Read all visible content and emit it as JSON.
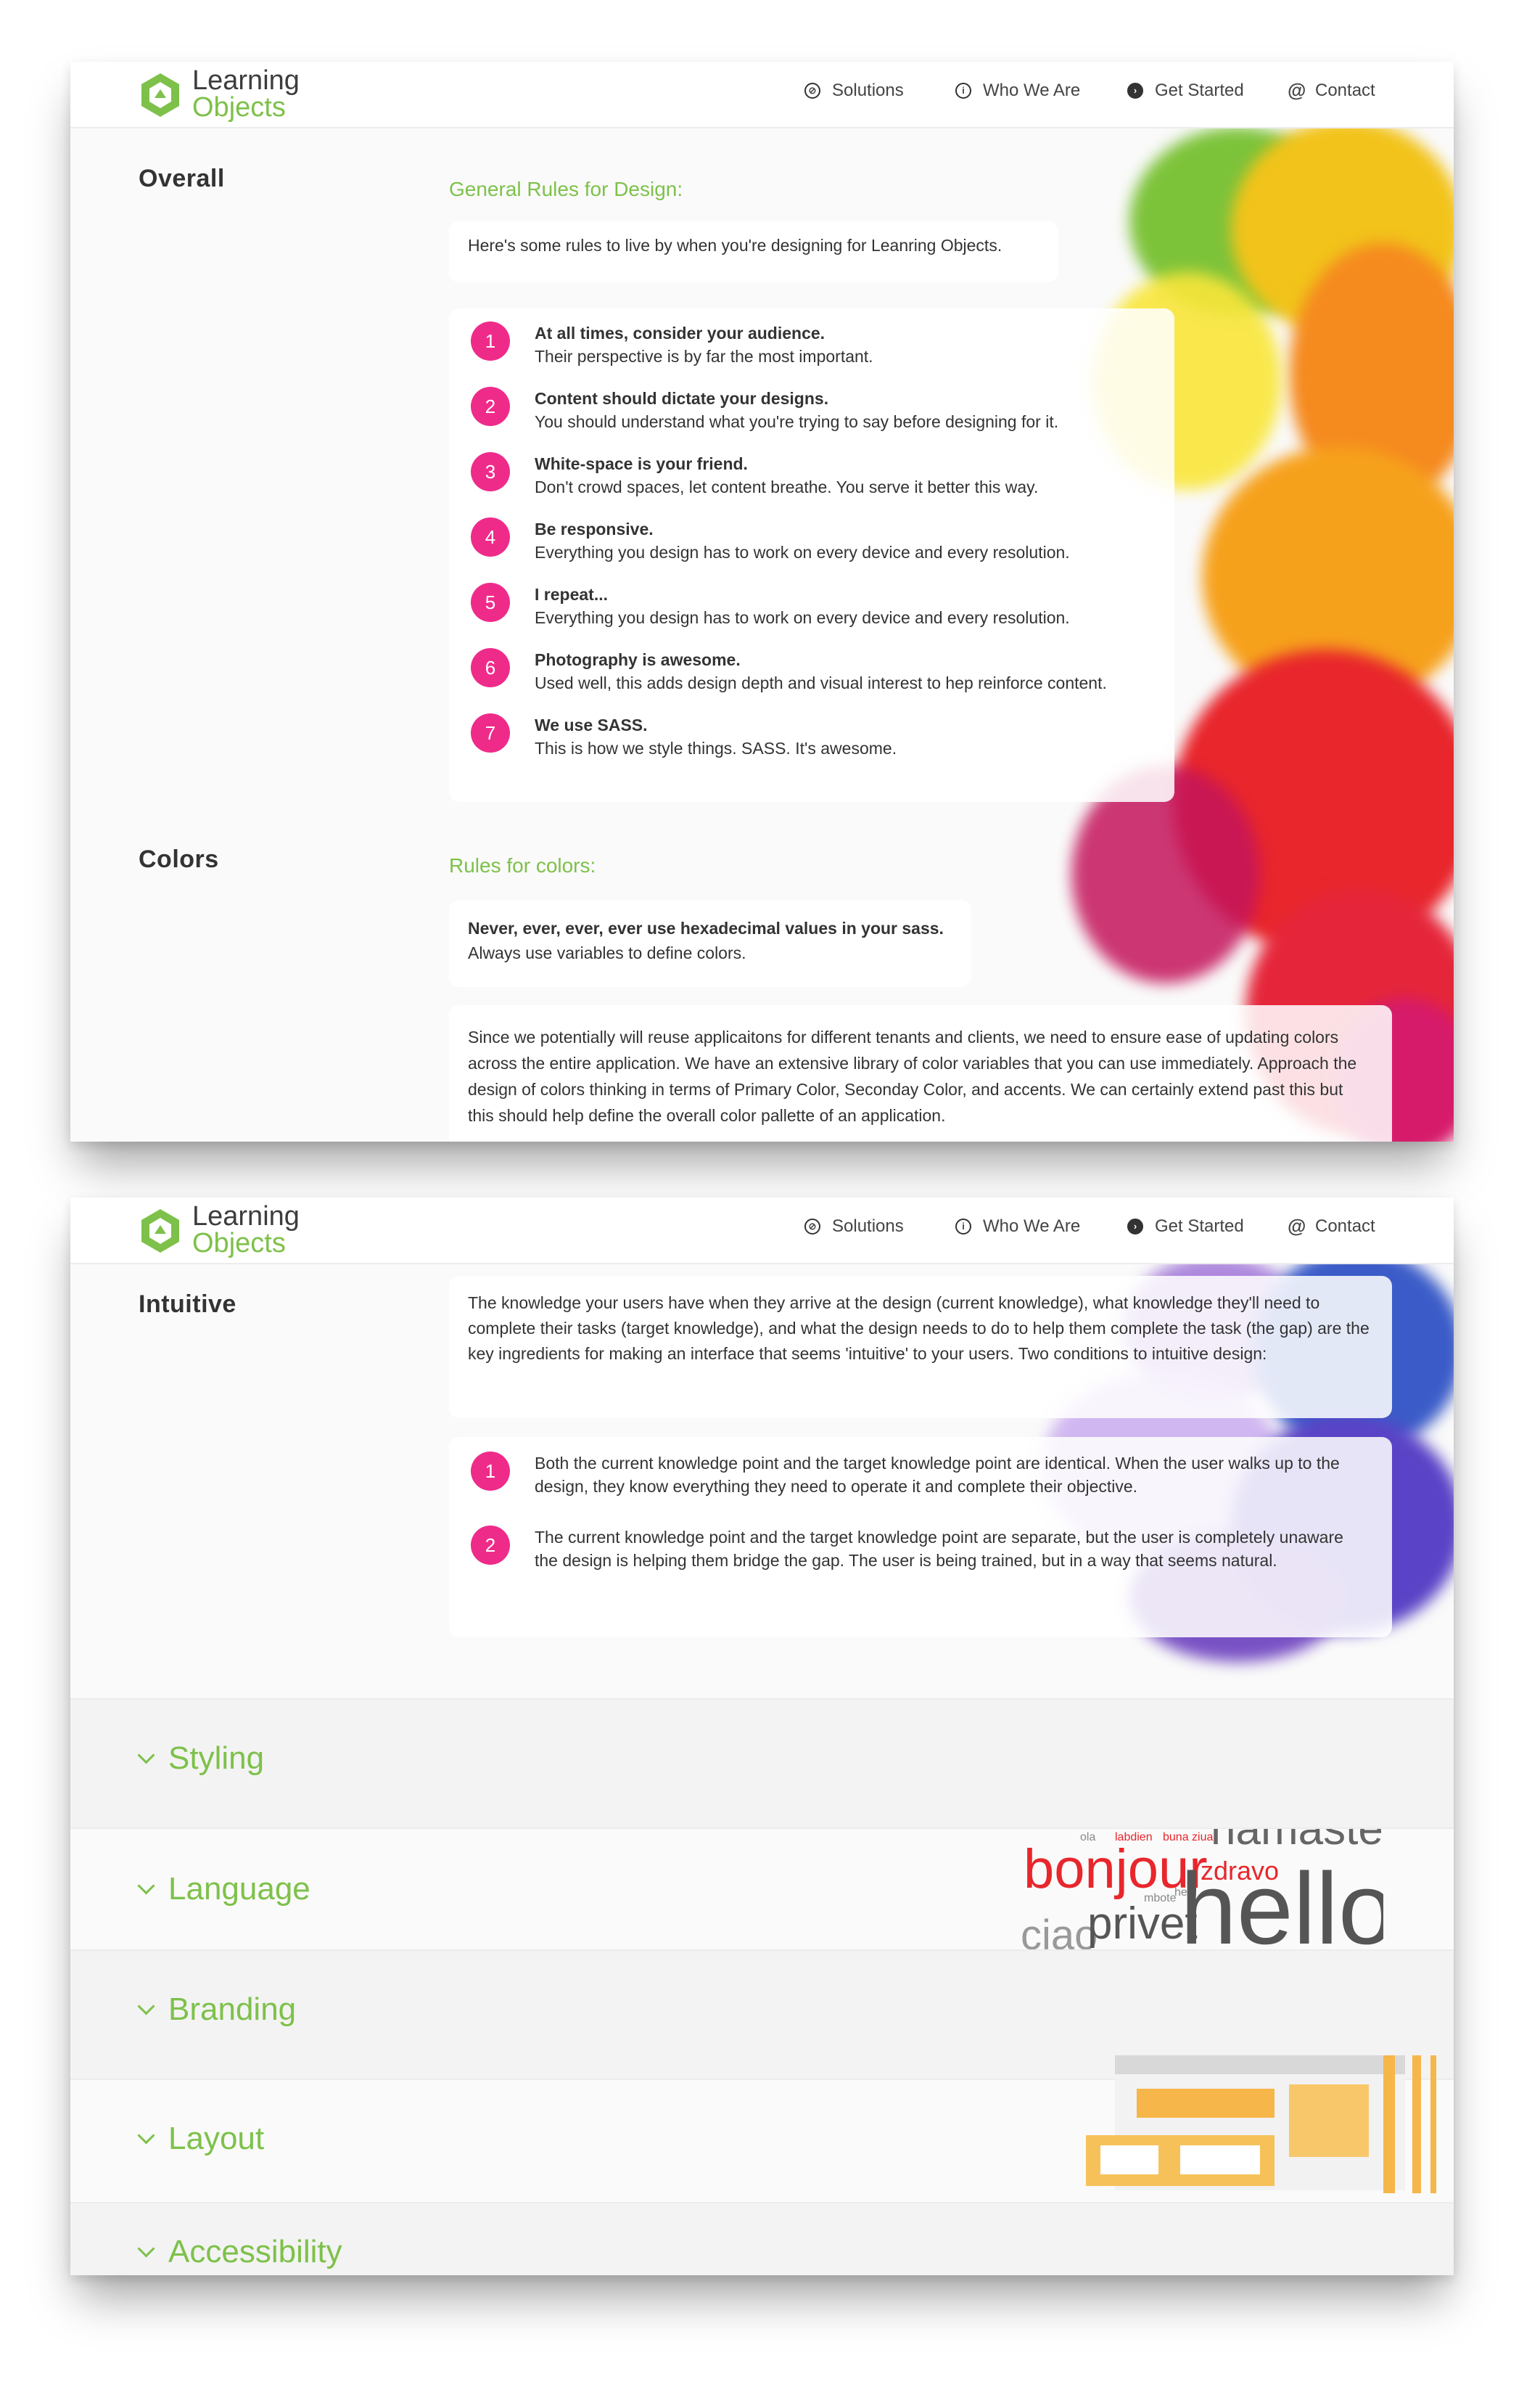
{
  "header": {
    "logo_line1": "Learning",
    "logo_line2": "Objects",
    "nav": [
      {
        "label": "Solutions",
        "icon": "compass-icon"
      },
      {
        "label": "Who We Are",
        "icon": "info-icon"
      },
      {
        "label": "Get Started",
        "icon": "arrow-right-circle-icon"
      },
      {
        "label": "Contact",
        "icon": "at-icon"
      }
    ]
  },
  "overall": {
    "label": "Overall",
    "heading": "General Rules for Design:",
    "intro": "Here's some rules to live by when you're designing for Leanring Objects.",
    "rules": [
      {
        "num": "1",
        "title": "At all times, consider your audience.",
        "body": "Their perspective is by far the most important."
      },
      {
        "num": "2",
        "title": "Content should dictate your designs.",
        "body": "You should understand what you're trying to say before designing for it."
      },
      {
        "num": "3",
        "title": "White-space is your friend.",
        "body": "Don't crowd spaces, let content breathe. You serve it better this way."
      },
      {
        "num": "4",
        "title": "Be responsive.",
        "body": "Everything you design has to work on every device and every resolution."
      },
      {
        "num": "5",
        "title": "I repeat...",
        "body": "Everything you design has to work on every device and every resolution."
      },
      {
        "num": "6",
        "title": "Photography is awesome.",
        "body": "Used well, this adds design depth and visual interest to hep reinforce content."
      },
      {
        "num": "7",
        "title": "We use SASS.",
        "body": "This is how we style things. SASS. It's awesome."
      }
    ]
  },
  "colors": {
    "label": "Colors",
    "heading": "Rules for colors:",
    "rule_bold": "Never, ever, ever, ever use hexadecimal values in your sass.",
    "rule_body": "Always use variables to define colors.",
    "paragraph": "Since we potentially will reuse applicaitons for different tenants and clients, we need to ensure ease of updating colors across the entire application. We have an extensive library of color variables that you can use immediately. Approach the design of colors thinking in terms of Primary Color, Seconday Color, and accents. We can certainly extend past this but this should help define the overall color pallette of an application."
  },
  "intuitive": {
    "label": "Intuitive",
    "paragraph": "The knowledge your users have when they arrive at the design (current knowledge), what knowledge they'll need to complete their tasks (target knowledge), and what the design needs to do to help them complete the task (the gap) are the key ingredients for making an interface that seems 'intuitive' to your users. Two conditions to intuitive design:",
    "conditions": [
      {
        "num": "1",
        "text": "Both the current knowledge point and the target knowledge point are identical. When the user walks up to the design, they know everything they need to operate it and complete their objective."
      },
      {
        "num": "2",
        "text": "The current knowledge point and the target knowledge point are separate, but the user is completely unaware the design is helping them bridge the gap. The user is being trained, but in a way that seems natural."
      }
    ]
  },
  "accordion": [
    {
      "label": "Styling"
    },
    {
      "label": "Language"
    },
    {
      "label": "Branding"
    },
    {
      "label": "Layout"
    },
    {
      "label": "Accessibility"
    }
  ],
  "wordcloud": {
    "words": [
      "ola",
      "labdien",
      "buna ziua",
      "namaste",
      "bonjour",
      "zdravo",
      "mbote",
      "hei",
      "ciao",
      "privet",
      "hello"
    ]
  },
  "colors_palette": {
    "brand_green": "#7dc14a",
    "accent_pink": "#ef2b8a",
    "text_dark": "#333333"
  }
}
